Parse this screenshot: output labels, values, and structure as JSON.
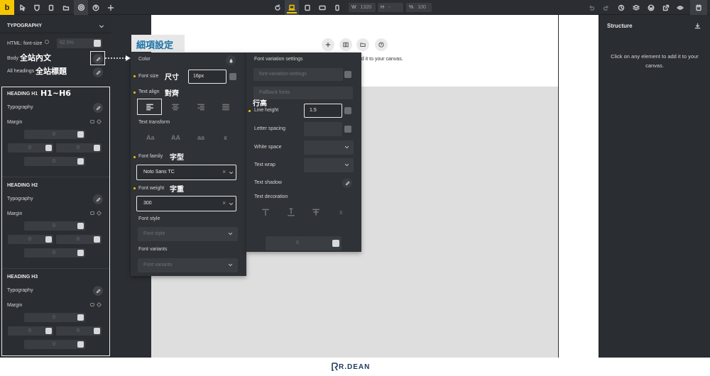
{
  "app": {
    "logo": "b"
  },
  "topbar": {
    "left_icons": [
      "cursor-icon",
      "shield-icon",
      "pages-icon",
      "folder-icon",
      "gear-icon",
      "help-icon",
      "plus-icon"
    ],
    "center_icons": [
      "refresh-icon",
      "desktop-icon",
      "tablet-landscape-icon",
      "tablet-icon",
      "mobile-icon"
    ],
    "width_label": "W",
    "width_value": "1320",
    "height_label": "H",
    "height_value": "-",
    "zoom_label": "%",
    "zoom_value": "100",
    "right_icons": [
      "undo-icon",
      "redo-icon",
      "history-icon",
      "layers-icon",
      "wordpress-icon",
      "external-link-icon",
      "preview-icon"
    ],
    "save_icon": "save-icon"
  },
  "left": {
    "section_title": "TYPOGRAPHY",
    "html_font_size_label": "HTML: font-size",
    "html_font_size_value": "62.5%",
    "body_label": "Body",
    "body_cjk": "全站內文",
    "all_headings_label": "All headings",
    "all_headings_cjk": "全站標題",
    "h_cjk": "H1~H6",
    "headings": [
      {
        "title": "HEADING H1",
        "typography": "Typography",
        "margin": "Margin",
        "values": [
          "0",
          "0",
          "0",
          "0"
        ]
      },
      {
        "title": "HEADING H2",
        "typography": "Typography",
        "margin": "Margin",
        "values": [
          "0",
          "0",
          "0",
          "0"
        ]
      },
      {
        "title": "HEADING H3",
        "typography": "Typography",
        "margin": "Margin",
        "values": [
          "0",
          "0",
          "0",
          "0"
        ]
      }
    ]
  },
  "callout": {
    "text": "細項設定"
  },
  "canvas": {
    "toolbar_icons": [
      "add-icon",
      "columns-icon",
      "folder-icon",
      "help-icon"
    ],
    "hint": "dd it to your canvas."
  },
  "popup_left": {
    "color": "Color",
    "font_size": "Font size",
    "font_size_cjk": "尺寸",
    "font_size_value": "16px",
    "text_align": "Text align",
    "text_align_cjk": "對齊",
    "text_transform": "Text transform",
    "transforms": [
      "Aa",
      "AA",
      "aa",
      "x"
    ],
    "font_family": "Font family",
    "font_family_cjk": "字型",
    "font_family_value": "Noto Sans TC",
    "font_weight": "Font weight",
    "font_weight_cjk": "字重",
    "font_weight_value": "300",
    "font_style": "Font style",
    "font_style_placeholder": "Font style",
    "font_variants": "Font variants",
    "font_variants_placeholder": "Font variants"
  },
  "popup_right": {
    "font_variation": "Font variation settings",
    "font_variation_placeholder": "font-variation-settings",
    "fallback_placeholder": "Fallback fonts",
    "line_height_cjk": "行高",
    "line_height": "Line height",
    "line_height_value": "1.5",
    "letter_spacing": "Letter spacing",
    "white_space": "White space",
    "text_wrap": "Text wrap",
    "text_shadow": "Text shadow",
    "text_decoration": "Text decoration",
    "decorations": [
      "overline",
      "underline",
      "line-through",
      "x"
    ],
    "bottom_value": "0"
  },
  "right": {
    "title": "Structure",
    "message": "Click on any element to add it to your canvas."
  },
  "footer": {
    "brand": "R.DEAN"
  },
  "colors": {
    "accent": "#f6c700",
    "panel": "#2a2d31",
    "popup": "#2f3236"
  }
}
